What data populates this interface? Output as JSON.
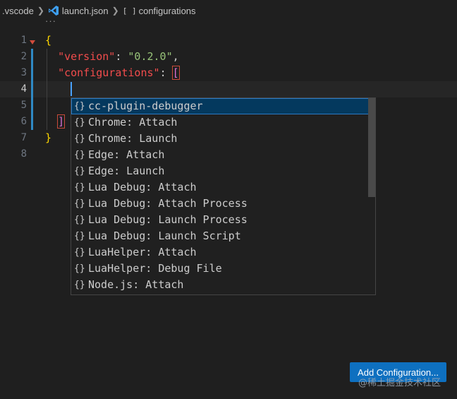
{
  "breadcrumb": {
    "folder": ".vscode",
    "file": "launch.json",
    "symbol_icon": "[ ]",
    "symbol": "configurations"
  },
  "ellipsis": "···",
  "editor": {
    "lines": [
      {
        "number": "1"
      },
      {
        "number": "2"
      },
      {
        "number": "3"
      },
      {
        "number": "4"
      },
      {
        "number": "5"
      },
      {
        "number": "6"
      },
      {
        "number": "7"
      },
      {
        "number": "8"
      }
    ],
    "tokens": {
      "open_brace": "{",
      "close_brace": "}",
      "version_key": "\"version\"",
      "version_value": "\"0.2.0\"",
      "configurations_key": "\"configurations\"",
      "colon": ": ",
      "comma": ",",
      "open_bracket": "[",
      "close_bracket": "]"
    }
  },
  "suggestions": {
    "icon": "{}",
    "items": [
      "cc-plugin-debugger",
      "Chrome: Attach",
      "Chrome: Launch",
      "Edge: Attach",
      "Edge: Launch",
      "Lua Debug: Attach",
      "Lua Debug: Attach Process",
      "Lua Debug: Launch Process",
      "Lua Debug: Launch Script",
      "LuaHelper: Attach",
      "LuaHelper: Debug File",
      "Node.js: Attach"
    ],
    "selected_index": 0
  },
  "add_configuration_button": "Add Configuration...",
  "watermark": "@稀土掘金技术社区",
  "colors": {
    "accent": "#0e70c0",
    "selection": "#04395e",
    "key": "#f14c4c",
    "string": "#98c379",
    "brace": "#ffd700"
  }
}
